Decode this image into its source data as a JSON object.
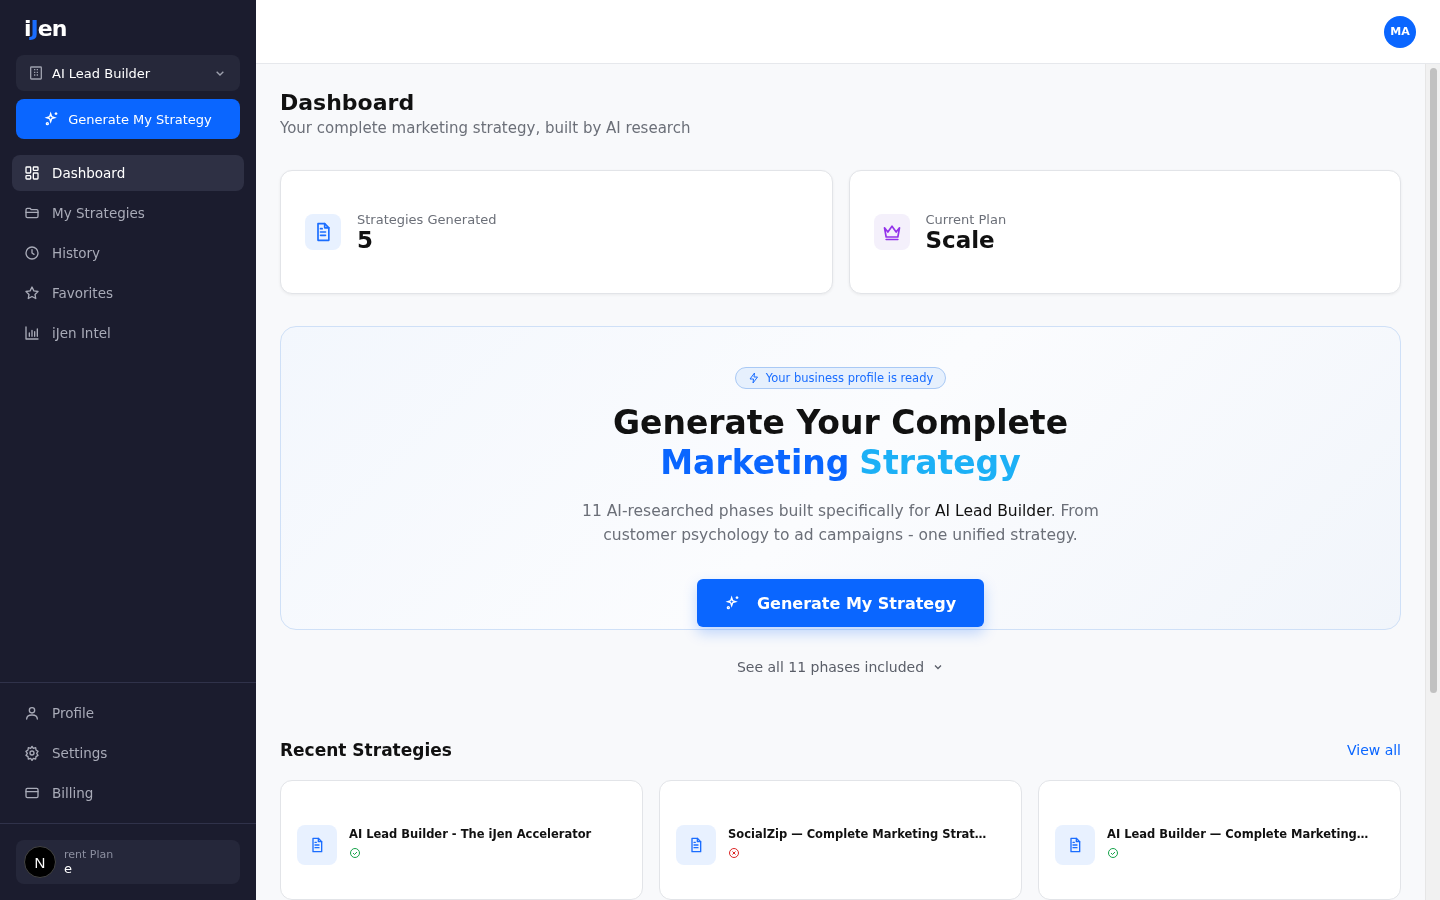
{
  "sidebar": {
    "logo": {
      "before": "i",
      "accent": "J",
      "after": "en"
    },
    "business": "AI Lead Builder",
    "cta": "Generate My Strategy",
    "nav": [
      {
        "label": "Dashboard",
        "selected": true
      },
      {
        "label": "My Strategies",
        "selected": false
      },
      {
        "label": "History",
        "selected": false
      },
      {
        "label": "Favorites",
        "selected": false
      },
      {
        "label": "iJen Intel",
        "selected": false
      }
    ],
    "account": [
      {
        "label": "Profile",
        "selected": false
      },
      {
        "label": "Settings",
        "selected": false
      },
      {
        "label": "Billing",
        "selected": false
      }
    ],
    "plan": {
      "label": "rent Plan",
      "value": "e",
      "badge": "N"
    }
  },
  "header": {
    "avatar": "MA"
  },
  "page": {
    "title": "Dashboard",
    "subtitle": "Your complete marketing strategy, built by AI research"
  },
  "stats": [
    {
      "label": "Strategies Generated",
      "value": "5"
    },
    {
      "label": "Current Plan",
      "value": "Scale"
    }
  ],
  "hero": {
    "badge": "Your business profile is ready",
    "title_line1": "Generate Your Complete",
    "title_word1": "Marketing",
    "title_word2": "Strategy",
    "text": "11 AI-researched phases built specifically for **AI Lead Builder**. From customer psychology to ad campaigns - one unified strategy.",
    "button": "Generate My Strategy"
  },
  "phases_toggle": {
    "label": "See all 11 phases included",
    "expanded": false
  },
  "recent": {
    "title": "Recent Strategies",
    "link": "View all",
    "items": [
      {
        "title": "AI Lead Builder - The iJen Accelerator",
        "kind": "complete"
      },
      {
        "title": "SocialZip — Complete Marketing Strat…",
        "kind": "failed"
      },
      {
        "title": "AI Lead Builder — Complete Marketing…",
        "kind": "complete"
      }
    ]
  }
}
